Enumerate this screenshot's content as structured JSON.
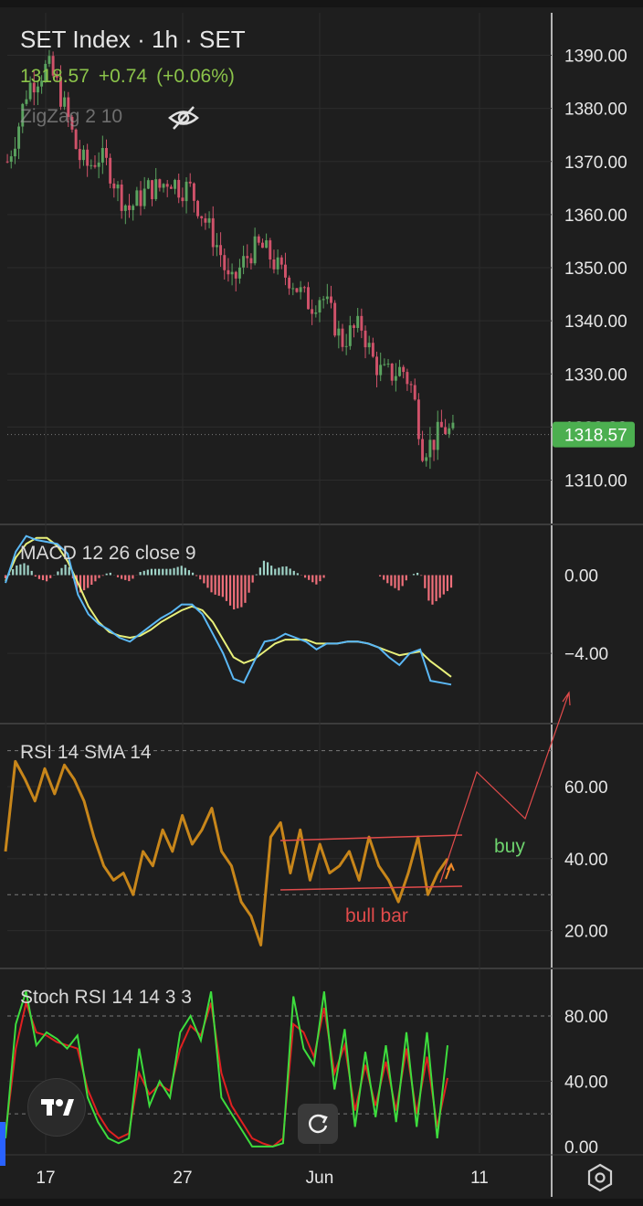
{
  "header": {
    "title": "SET Index · 1h · SET",
    "last": "1318.57",
    "change": "+0.74",
    "change_pct": "(+0.06%)",
    "indicator": "ZigZag 2 10",
    "eye_icon": "eye-slash-icon"
  },
  "panes": {
    "price": {
      "axis_labels": [
        "1390.00",
        "1380.00",
        "1370.00",
        "1360.00",
        "1350.00",
        "1340.00",
        "1330.00",
        "1310.00"
      ],
      "last_tag": "1318.57"
    },
    "macd": {
      "label": "MACD 12 26 close 9",
      "axis_labels": [
        "0.00",
        "−4.00"
      ]
    },
    "rsi": {
      "label": "RSI 14 SMA 14",
      "axis_labels": [
        "60.00",
        "40.00",
        "20.00"
      ]
    },
    "stoch": {
      "label": "Stoch RSI 14 14 3 3",
      "axis_labels": [
        "80.00",
        "40.00",
        "0.00"
      ]
    }
  },
  "x_axis": {
    "labels": [
      "17",
      "27",
      "Jun",
      "11"
    ]
  },
  "annotations": {
    "buy": "buy",
    "bull_bar": "bull bar"
  },
  "buttons": {
    "logo_icon": "tradingview-logo-icon",
    "reset_icon": "reset-chart-icon",
    "settings_icon": "settings-icon"
  },
  "colors": {
    "background": "#1e1e1e",
    "up": "#5aa35f",
    "down": "#d0526a",
    "price_tag": "#4caf50",
    "macd_line": "#5bb8f5",
    "signal_line": "#e8f07a",
    "rsi_line": "#c8861a",
    "stoch_k": "#3ddc3d",
    "stoch_d": "#e02020",
    "annotation": "#e14b4b",
    "buy_text": "#6ed36e"
  },
  "chart_data": [
    {
      "type": "candlestick",
      "title": "SET Index · 1h · SET",
      "ylim": [
        1302,
        1398
      ],
      "y_ticks": [
        1310,
        1320,
        1330,
        1340,
        1350,
        1360,
        1370,
        1380,
        1390
      ],
      "close_path": [
        1370,
        1376,
        1384,
        1386,
        1388,
        1384,
        1378,
        1371,
        1369,
        1371,
        1369,
        1364,
        1361,
        1363,
        1365,
        1365,
        1367,
        1365,
        1365,
        1361,
        1357,
        1353,
        1346,
        1350,
        1353,
        1354,
        1352,
        1349,
        1348,
        1345,
        1343,
        1345,
        1341,
        1336,
        1338,
        1339,
        1333,
        1330,
        1330,
        1331,
        1327,
        1316,
        1317,
        1320,
        1318.57
      ],
      "last": 1318.57
    },
    {
      "type": "line",
      "title": "MACD 12 26 close 9",
      "ylim": [
        -7.5,
        2.5
      ],
      "y_ticks": [
        0,
        -4
      ],
      "series": [
        {
          "name": "MACD",
          "values": [
            -0.4,
            1.2,
            2.0,
            1.8,
            1.7,
            1.6,
            1.1,
            -1.0,
            -2.0,
            -2.5,
            -2.8,
            -3.2,
            -3.4,
            -3.0,
            -2.6,
            -2.2,
            -1.9,
            -1.5,
            -1.5,
            -2.0,
            -3.0,
            -4.0,
            -5.3,
            -5.5,
            -4.4,
            -3.4,
            -3.3,
            -3.0,
            -3.2,
            -3.4,
            -3.8,
            -3.5,
            -3.5,
            -3.4,
            -3.4,
            -3.5,
            -3.7,
            -4.2,
            -4.6,
            -4.0,
            -3.8,
            -5.4,
            -5.5,
            -5.6
          ]
        },
        {
          "name": "Signal",
          "values": [
            -0.3,
            0.9,
            1.6,
            1.9,
            1.9,
            1.5,
            0.7,
            -0.4,
            -1.6,
            -2.4,
            -2.9,
            -3.1,
            -3.2,
            -3.1,
            -2.8,
            -2.4,
            -2.1,
            -1.8,
            -1.6,
            -1.8,
            -2.4,
            -3.3,
            -4.2,
            -4.5,
            -4.3,
            -3.9,
            -3.5,
            -3.3,
            -3.3,
            -3.3,
            -3.5,
            -3.5,
            -3.5,
            -3.4,
            -3.4,
            -3.5,
            -3.7,
            -3.9,
            -4.1,
            -4.0,
            -3.9,
            -4.4,
            -4.8,
            -5.2
          ]
        }
      ]
    },
    {
      "type": "line",
      "title": "RSI 14 SMA 14",
      "ylim": [
        10,
        77
      ],
      "y_ticks": [
        20,
        40,
        60
      ],
      "bands": [
        30,
        70
      ],
      "series": [
        {
          "name": "RSI",
          "values": [
            42,
            67,
            62,
            56,
            65,
            58,
            66,
            62,
            56,
            46,
            38,
            34,
            36,
            30,
            42,
            38,
            48,
            42,
            52,
            44,
            48,
            54,
            42,
            38,
            28,
            24,
            16,
            46,
            50,
            36,
            48,
            34,
            44,
            36,
            38,
            42,
            34,
            46,
            38,
            34,
            28,
            36,
            46,
            30,
            36,
            40
          ]
        }
      ]
    },
    {
      "type": "line",
      "title": "Stoch RSI 14 14 3 3",
      "ylim": [
        -4,
        108
      ],
      "y_ticks": [
        0,
        40,
        80
      ],
      "bands": [
        20,
        80
      ],
      "series": [
        {
          "name": "K",
          "values": [
            5,
            75,
            95,
            62,
            70,
            66,
            60,
            68,
            30,
            15,
            5,
            2,
            5,
            60,
            25,
            40,
            30,
            70,
            80,
            65,
            95,
            30,
            20,
            10,
            0,
            0,
            0,
            2,
            92,
            60,
            50,
            95,
            35,
            72,
            12,
            58,
            18,
            62,
            15,
            70,
            12,
            70,
            5,
            62
          ]
        },
        {
          "name": "D",
          "values": [
            8,
            60,
            88,
            70,
            68,
            64,
            62,
            60,
            35,
            20,
            10,
            5,
            8,
            45,
            32,
            38,
            34,
            60,
            74,
            68,
            88,
            45,
            25,
            15,
            5,
            2,
            0,
            5,
            75,
            70,
            55,
            85,
            45,
            62,
            22,
            50,
            25,
            52,
            22,
            60,
            20,
            55,
            12,
            42
          ]
        }
      ]
    }
  ]
}
